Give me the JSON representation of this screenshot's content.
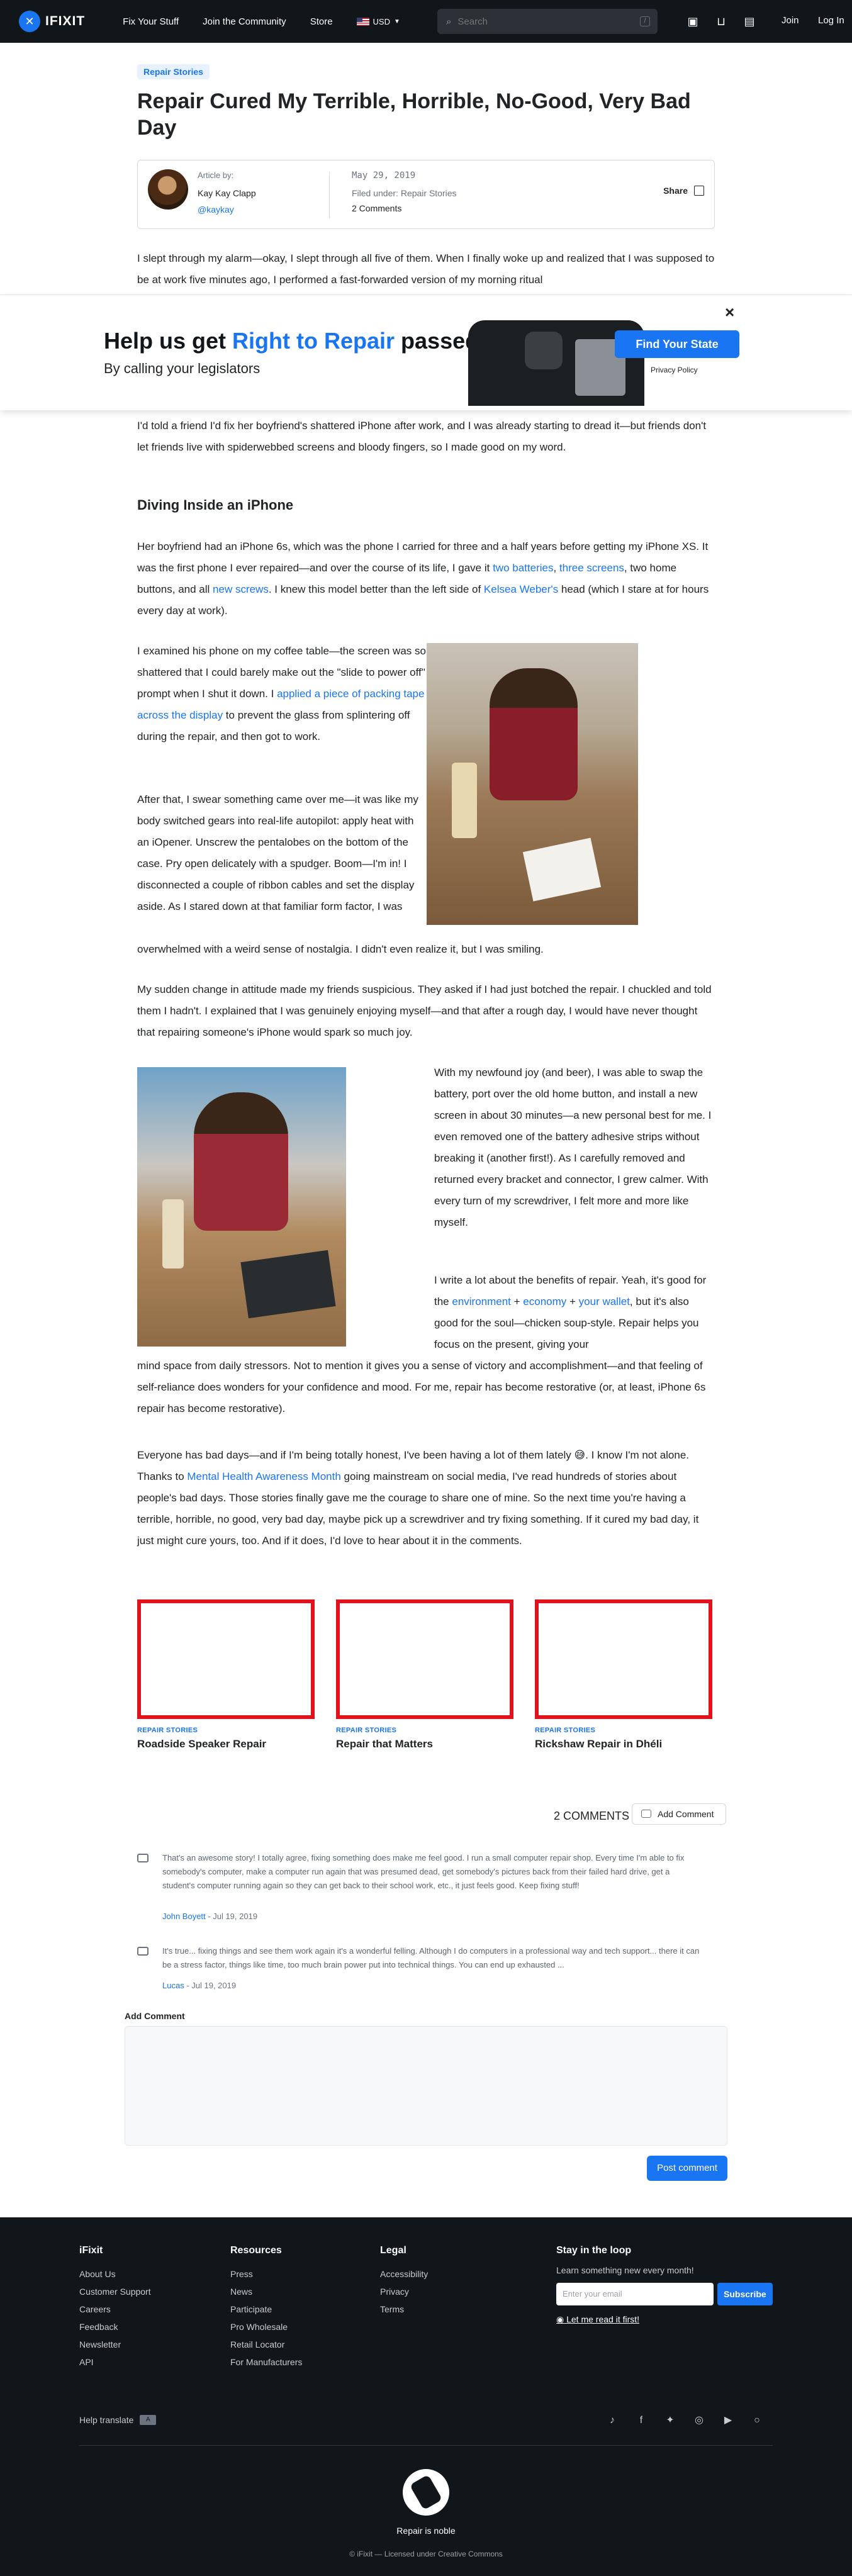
{
  "nav": {
    "logo": "IFIXIT",
    "links": [
      "Fix Your Stuff",
      "Join the Community",
      "Store"
    ],
    "currency": "USD",
    "search_placeholder": "Search",
    "search_shortcut": "/",
    "join": "Join",
    "login": "Log In"
  },
  "article": {
    "tag": "Repair Stories",
    "title": "Repair Cured My Terrible, Horrible, No-Good, Very Bad Day",
    "byline_label": "Article by:",
    "author": "Kay Kay Clapp",
    "handle": "@kaykay",
    "date": "May 29, 2019",
    "filed_label": "Filed under:",
    "filed_under": "Repair Stories",
    "comments": "2 Comments",
    "share": "Share"
  },
  "banner": {
    "title_pre": "Help us get ",
    "title_hl": "Right to Repair",
    "title_post": " passed",
    "subtitle": "By calling your legislators",
    "cta": "Find Your State",
    "privacy": "Privacy Policy",
    "close": "×"
  },
  "body": {
    "p1": "I slept through my alarm—okay, I slept through all five of them. When I finally woke up and realized that I was supposed to be at work five minutes ago, I performed a fast-forwarded version of my morning ritual",
    "p2": "I'd told a friend I'd fix her boyfriend's shattered iPhone after work, and I was already starting to dread it—but friends don't let friends live with spiderwebbed screens and bloody fingers, so I made good on my word.",
    "h_diving": "Diving Inside an iPhone",
    "p3": {
      "a": "Her boyfriend had an iPhone 6s, which was the phone I carried for three and a half years before getting my iPhone XS. It was the first phone I ever repaired—and over the course of its life, I gave it ",
      "l1": "two batteries",
      "b": ", ",
      "l2": "three screens",
      "c": ", two home buttons, and all ",
      "l3": "new screws",
      "d": ". I knew this model better than the left side of ",
      "l4": "Kelsea Weber's",
      "e": " head (which I stare at for hours every day at work)."
    },
    "p4": {
      "a": "I examined his phone on my coffee table—the screen was so shattered that I could barely make out the \"slide to power off\" prompt when I shut it down. I ",
      "l1": "applied a piece of packing tape across the display",
      "b": " to prevent the glass from splintering off during the repair, and then got to work."
    },
    "p5a": "After that, I swear something came over me—it was like my body switched gears into real-life autopilot: apply heat with an iOpener. Unscrew the pentalobes on the bottom of the case. Pry open delicately with a spudger. Boom—I'm in! I disconnected a couple of ribbon cables and set the display aside. As I stared down at that familiar form factor, I was",
    "p5b": "overwhelmed with a weird sense of nostalgia. I didn't even realize it, but I was smiling.",
    "p6": "My sudden change in attitude made my friends suspicious. They asked if I had just botched the repair. I chuckled and told them I hadn't. I explained that I was genuinely enjoying myself—and that after a rough day, I would have never thought that repairing someone's iPhone would spark so much joy.",
    "p7": "With my newfound joy (and beer), I was able to swap the battery, port over the old home button, and install a new screen in about 30 minutes—a new personal best for me. I even removed one of the battery adhesive strips without breaking it (another first!). As I carefully removed and returned every bracket and connector, I grew calmer. With every turn of my screwdriver, I felt more and more like myself.",
    "p8": {
      "a": "I write a lot about the benefits of repair. Yeah, it's good for the ",
      "l1": "environment",
      "b": " + ",
      "l2": "economy",
      "c": " + ",
      "l3": "your wallet",
      "d": ", but it's also good for the soul—chicken soup-style. Repair helps you focus on the present, giving your",
      "e": "mind space from daily stressors. Not to mention it gives you a sense of victory and accomplishment—and that feeling of self-reliance does wonders for your confidence and mood. For me, repair has become restorative (or, at least, iPhone 6s repair has become restorative)."
    },
    "p9": {
      "a": "Everyone has bad days—and if I'm being totally honest, I've been having a lot of them lately 😅. I know I'm not alone. Thanks to ",
      "l1": "Mental Health Awareness Month",
      "b": " going mainstream on social media, I've read hundreds of stories about people's bad days. Those stories finally gave me the courage to share one of mine. So the next time you're having a terrible, horrible, no good, very bad day, maybe pick up a screwdriver and try fixing something. If it cured my bad day, it just might cure yours, too. And if it does, I'd love to hear about it in the comments."
    }
  },
  "related": [
    {
      "tag": "REPAIR STORIES",
      "title": "Roadside Speaker Repair"
    },
    {
      "tag": "REPAIR STORIES",
      "title": "Repair that Matters"
    },
    {
      "tag": "REPAIR STORIES",
      "title": "Rickshaw Repair in Dhéli"
    }
  ],
  "comments": {
    "count": "2 COMMENTS",
    "add_button": "Add Comment",
    "items": [
      {
        "text": "That's an awesome story! I totally agree, fixing something does make me feel good. I run a small computer repair shop. Every time I'm able to fix somebody's computer, make a computer run again that was presumed dead, get somebody's pictures back from their failed hard drive, get a student's computer running again so they can get back to their school work, etc., it just feels good. Keep fixing stuff!",
        "author": "John Boyett",
        "date": " - Jul 19, 2019"
      },
      {
        "text": "It's true... fixing things and see them work again it's a wonderful felling. Although I do computers in a professional way and tech support... there it can be a stress factor, things like time, too much brain power put into technical things. You can end up exhausted ...",
        "author": "Lucas",
        "date": " - Jul 19, 2019"
      }
    ],
    "form_label": "Add Comment",
    "post": "Post comment"
  },
  "footer": {
    "ifixit": {
      "head": "iFixit",
      "links": [
        "About Us",
        "Customer Support",
        "Careers",
        "Feedback",
        "Newsletter",
        "API"
      ]
    },
    "resources": {
      "head": "Resources",
      "links": [
        "Press",
        "News",
        "Participate",
        "Pro Wholesale",
        "Retail Locator",
        "For Manufacturers"
      ]
    },
    "legal": {
      "head": "Legal",
      "links": [
        "Accessibility",
        "Privacy",
        "Terms"
      ]
    },
    "newsletter": {
      "head": "Stay in the loop",
      "sub": "Learn something new every month!",
      "placeholder": "Enter your email",
      "button": "Subscribe",
      "read": "Let me read it first!"
    },
    "help_translate": "Help translate",
    "noble": "Repair is noble",
    "licensed": "© iFixit — Licensed under Creative Commons"
  }
}
